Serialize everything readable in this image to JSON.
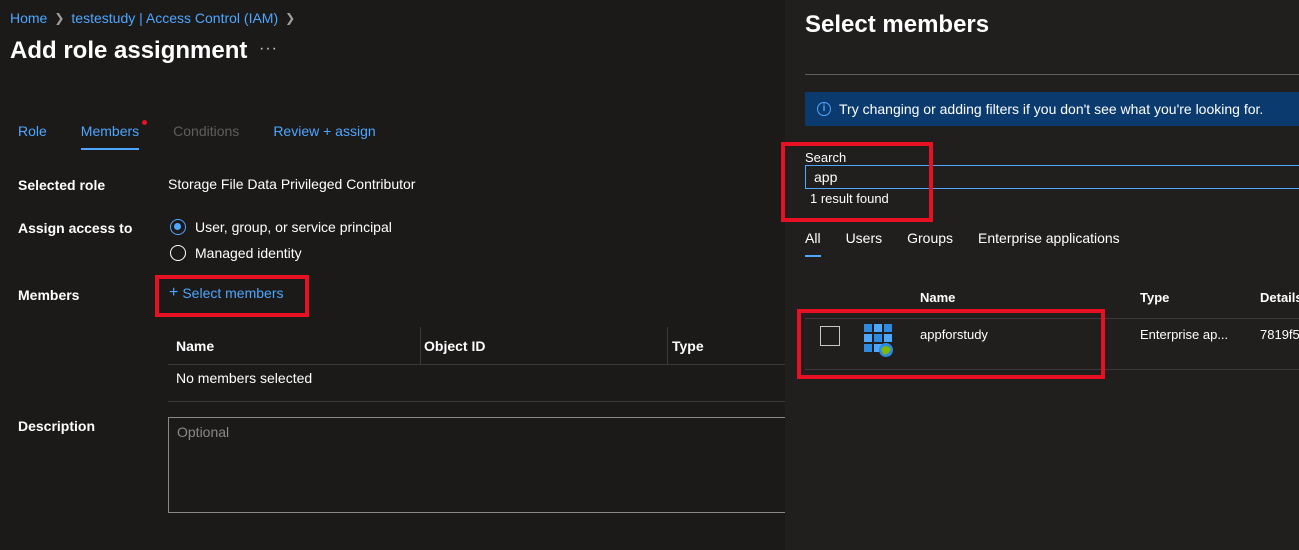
{
  "breadcrumb": {
    "home": "Home",
    "parent": "testestudy | Access Control (IAM)"
  },
  "page": {
    "title": "Add role assignment",
    "more": "···"
  },
  "tabs": [
    {
      "label": "Role"
    },
    {
      "label": "Members"
    },
    {
      "label": "Conditions"
    },
    {
      "label": "Review + assign"
    }
  ],
  "form": {
    "selected_role_label": "Selected role",
    "selected_role_value": "Storage File Data Privileged Contributor",
    "assign_access_label": "Assign access to",
    "option_user": "User, group, or service principal",
    "option_managed": "Managed identity",
    "members_label": "Members",
    "select_members_link": "Select members",
    "description_label": "Description",
    "description_placeholder": "Optional"
  },
  "members_table": {
    "columns": [
      "Name",
      "Object ID",
      "Type"
    ],
    "empty_text": "No members selected"
  },
  "panel": {
    "title": "Select members",
    "info_text": "Try changing or adding filters if you don't see what you're looking for.",
    "search_label": "Search",
    "search_value": "app",
    "result_count": "1 result found",
    "filter_tabs": [
      "All",
      "Users",
      "Groups",
      "Enterprise applications"
    ],
    "columns": [
      "Name",
      "Type",
      "Details"
    ],
    "results": [
      {
        "name": "appforstudy",
        "type": "Enterprise ap...",
        "details": "7819f5"
      }
    ]
  },
  "colors": {
    "accent": "#4da6ff",
    "highlight": "#e81123",
    "background": "#1b1a19",
    "panel": "#201f1e",
    "info": "#0b3b6e"
  },
  "icons": {
    "info": "info-icon",
    "app": "enterprise-app-icon",
    "chevron": "chevron-right-icon",
    "plus": "plus-icon"
  }
}
